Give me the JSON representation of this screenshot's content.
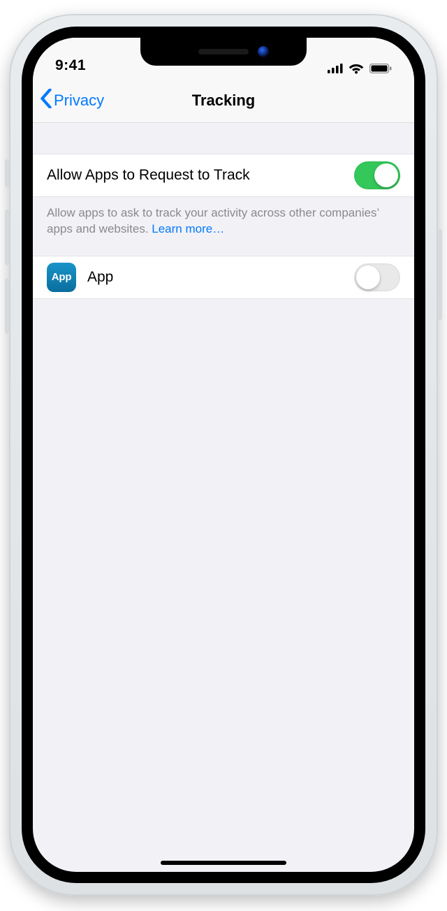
{
  "status": {
    "time": "9:41"
  },
  "nav": {
    "back_label": "Privacy",
    "title": "Tracking"
  },
  "settings": {
    "allow_label": "Allow Apps to Request to Track",
    "allow_on": true,
    "footer_text": "Allow apps to ask to track your activity across other companies’ apps and websites. ",
    "learn_more": "Learn more…"
  },
  "apps": [
    {
      "icon_label": "App",
      "name": "App",
      "on": false
    }
  ]
}
